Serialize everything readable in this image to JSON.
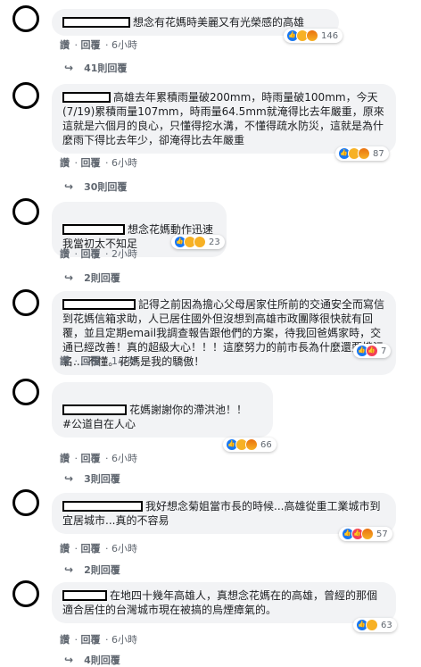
{
  "comments": [
    {
      "text": "想念有花媽時美麗又有光榮感的高雄",
      "actions": {
        "like": "讚",
        "reply": "回覆",
        "time": "6小時"
      },
      "reactions": {
        "icons": [
          "like-icon",
          "sad-icon",
          "angry-icon"
        ],
        "count": "146"
      },
      "replies": "41則回覆"
    },
    {
      "text": "高雄去年累積雨量破200mm，時雨量破100mm，今天(7/19)累積雨量107mm，時雨量64.5mm就淹得比去年嚴重，原來這就是六個月的良心，只懂得挖水溝，不懂得疏水防災，這就是為什麼雨下得比去年少，卻淹得比去年嚴重",
      "actions": {
        "like": "讚",
        "reply": "回覆",
        "time": "6小時"
      },
      "reactions": {
        "icons": [
          "like-icon",
          "sad-icon",
          "angry-icon"
        ],
        "count": "87"
      },
      "replies": "30則回覆"
    },
    {
      "text": "想念花媽動作迅速\n我當初太不知足",
      "actions": {
        "like": "讚",
        "reply": "回覆",
        "time": "2小時"
      },
      "reactions": {
        "icons": [
          "like-icon",
          "sad-icon",
          "haha-icon"
        ],
        "count": "23"
      },
      "replies": "2則回覆"
    },
    {
      "text": "記得之前因為擔心父母居家住所前的交通安全而寫信到花媽信箱求助，人已居住國外但沒想到高雄市政團隊很快就有回覆，並且定期email我調查報告跟他們的方案，待我回爸媽家時，交通已經改善！真的超級大心！！！這麼努力的前市長為什麼還要揹污名... 不懂。花媽是我的驕傲！",
      "actions": {
        "like": "讚",
        "reply": "回覆",
        "time": "1小時"
      },
      "reactions": {
        "icons": [
          "like-icon",
          "love-icon"
        ],
        "count": "7"
      },
      "replies": ""
    },
    {
      "text": "花媽謝謝你的滯洪池！！\n#公道自在人心",
      "actions": {
        "like": "讚",
        "reply": "回覆",
        "time": "6小時"
      },
      "reactions": {
        "icons": [
          "like-icon",
          "haha-icon",
          "angry-icon"
        ],
        "count": "66"
      },
      "replies": "3則回覆"
    },
    {
      "text": "我好想念菊姐當市長的時候...高雄從重工業城市到宜居城市...真的不容易",
      "actions": {
        "like": "讚",
        "reply": "回覆",
        "time": "6小時"
      },
      "reactions": {
        "icons": [
          "like-icon",
          "love-icon",
          "angry-icon"
        ],
        "count": "57"
      },
      "replies": "2則回覆"
    },
    {
      "text": "在地四十幾年高雄人，真想念花媽在的高雄，曾經的那個適合居住的台灣城市現在被搞的烏煙瘴氣的。",
      "actions": {
        "like": "讚",
        "reply": "回覆",
        "time": "6小時"
      },
      "reactions": {
        "icons": [
          "like-icon",
          "sad-icon"
        ],
        "count": "63"
      },
      "replies": "4則回覆"
    }
  ]
}
